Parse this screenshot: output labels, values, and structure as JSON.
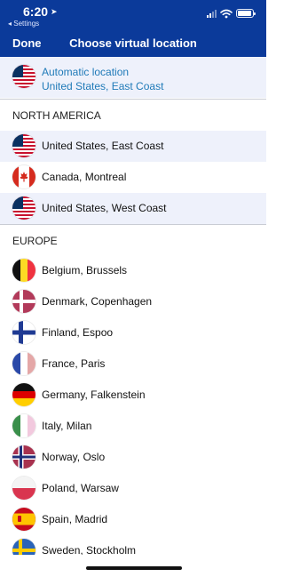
{
  "status_bar": {
    "time": "6:20",
    "location_arrow": "location-arrow-icon",
    "back_app": "◂ Settings",
    "battery_level": 0.95
  },
  "nav": {
    "done_label": "Done",
    "title": "Choose virtual location"
  },
  "automatic": {
    "title": "Automatic location",
    "subtitle": "United States, East Coast",
    "flag": "us-flag-icon"
  },
  "sections": {
    "north_america": {
      "header": "NORTH AMERICA",
      "items": [
        {
          "label": "United States, East Coast",
          "flag": "us-flag-icon"
        },
        {
          "label": "Canada, Montreal",
          "flag": "canada-flag-icon"
        },
        {
          "label": "United States, West Coast",
          "flag": "us-flag-icon"
        }
      ]
    },
    "europe": {
      "header": "EUROPE",
      "items": [
        {
          "label": "Belgium, Brussels",
          "flag": "belgium-flag-icon"
        },
        {
          "label": "Denmark, Copenhagen",
          "flag": "denmark-flag-icon"
        },
        {
          "label": "Finland, Espoo",
          "flag": "finland-flag-icon"
        },
        {
          "label": "France, Paris",
          "flag": "france-flag-icon"
        },
        {
          "label": "Germany, Falkenstein",
          "flag": "germany-flag-icon"
        },
        {
          "label": "Italy, Milan",
          "flag": "italy-flag-icon"
        },
        {
          "label": "Norway, Oslo",
          "flag": "norway-flag-icon"
        },
        {
          "label": "Poland, Warsaw",
          "flag": "poland-flag-icon"
        },
        {
          "label": "Spain, Madrid",
          "flag": "spain-flag-icon"
        },
        {
          "label": "Sweden, Stockholm",
          "flag": "sweden-flag-icon"
        }
      ]
    }
  },
  "colors": {
    "header_bg": "#0b3a9a",
    "row_highlight": "#eef1fb",
    "accent_text": "#1f7ab8"
  }
}
